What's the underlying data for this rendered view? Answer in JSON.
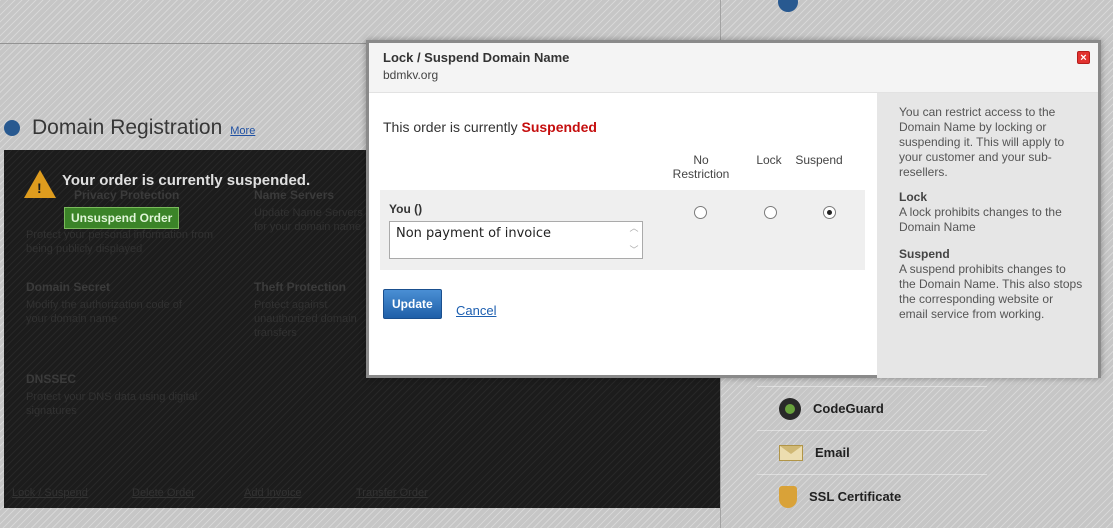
{
  "background": {
    "section_title": "Domain Registration",
    "more_link": "More",
    "suspended_banner": "Your order is currently suspended.",
    "unsuspend_button": "Unsuspend Order",
    "ghost_headings": {
      "privacy": "Privacy Protection",
      "name_servers": "Name Servers",
      "domain_secret": "Domain Secret",
      "theft_protection": "Theft Protection",
      "dnssec": "DNSSEC"
    },
    "ghost_texts": {
      "privacy": "Protect your personal information from being publicly displayed",
      "name_servers": "Update Name Servers for your domain name",
      "domain_secret": "Modify the authorization code of your domain name",
      "theft_protection": "Protect against unauthorized domain transfers",
      "dnssec": "Protect your DNS data using digital signatures"
    },
    "footer_links": [
      "Lock / Suspend",
      "Delete Order",
      "Add Invoice",
      "Transfer Order"
    ],
    "side_items": [
      {
        "label": "CodeGuard",
        "icon": "codeguard-icon"
      },
      {
        "label": "Email",
        "icon": "email-icon"
      },
      {
        "label": "SSL Certificate",
        "icon": "ssl-certificate-icon"
      }
    ]
  },
  "modal": {
    "title": "Lock / Suspend Domain Name",
    "subtitle": "bdmkv.org",
    "close_icon": "close-icon",
    "status_prefix": "This order is currently",
    "status_value": "Suspended",
    "status_color": "#c50e0e",
    "columns": {
      "no_restriction_line1": "No",
      "no_restriction_line2": "Restriction",
      "lock": "Lock",
      "suspend": "Suspend"
    },
    "row": {
      "label": "You ()",
      "reason_value": "Non payment of invoice",
      "selected": "Suspend"
    },
    "update_button": "Update",
    "cancel_link": "Cancel",
    "accent_color": "#1f5fa8",
    "help": {
      "intro": "You can restrict access to the Domain Name by locking or suspending it. This will apply to your customer and your sub-resellers.",
      "lock_title": "Lock",
      "lock_text": "A lock prohibits changes to the Domain Name",
      "suspend_title": "Suspend",
      "suspend_text": "A suspend prohibits changes to the Domain Name. This also stops the corresponding website or email service from working."
    }
  }
}
